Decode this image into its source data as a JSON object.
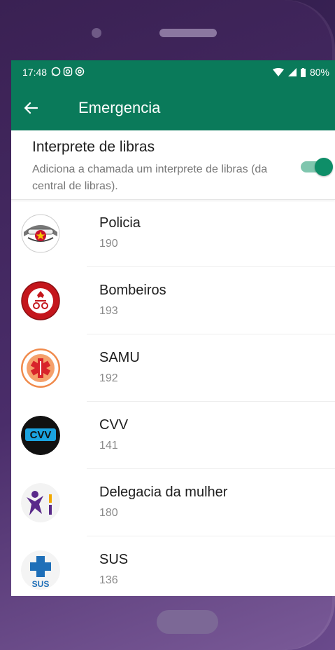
{
  "status_bar": {
    "time": "17:48",
    "notification_icons": [
      "whatsapp-icon",
      "instagram-icon",
      "at-icon"
    ],
    "battery": "80%"
  },
  "toolbar": {
    "title": "Emergencia",
    "back_icon": "arrow-left-icon",
    "color": "#0a7a5a"
  },
  "libras_toggle": {
    "title": "Interprete de libras",
    "description": "Adiciona a chamada um interprete de libras (da central de libras).",
    "enabled": true
  },
  "contacts": [
    {
      "name": "Policia",
      "number": "190",
      "logo": "policia-militar-logo"
    },
    {
      "name": "Bombeiros",
      "number": "193",
      "logo": "bombeiros-logo"
    },
    {
      "name": "SAMU",
      "number": "192",
      "logo": "samu-logo"
    },
    {
      "name": "CVV",
      "number": "141",
      "logo": "cvv-logo",
      "logo_text": "CVV"
    },
    {
      "name": "Delegacia da mulher",
      "number": "180",
      "logo": "delegacia-mulher-logo"
    },
    {
      "name": "SUS",
      "number": "136",
      "logo": "sus-logo",
      "logo_text": "SUS"
    }
  ]
}
